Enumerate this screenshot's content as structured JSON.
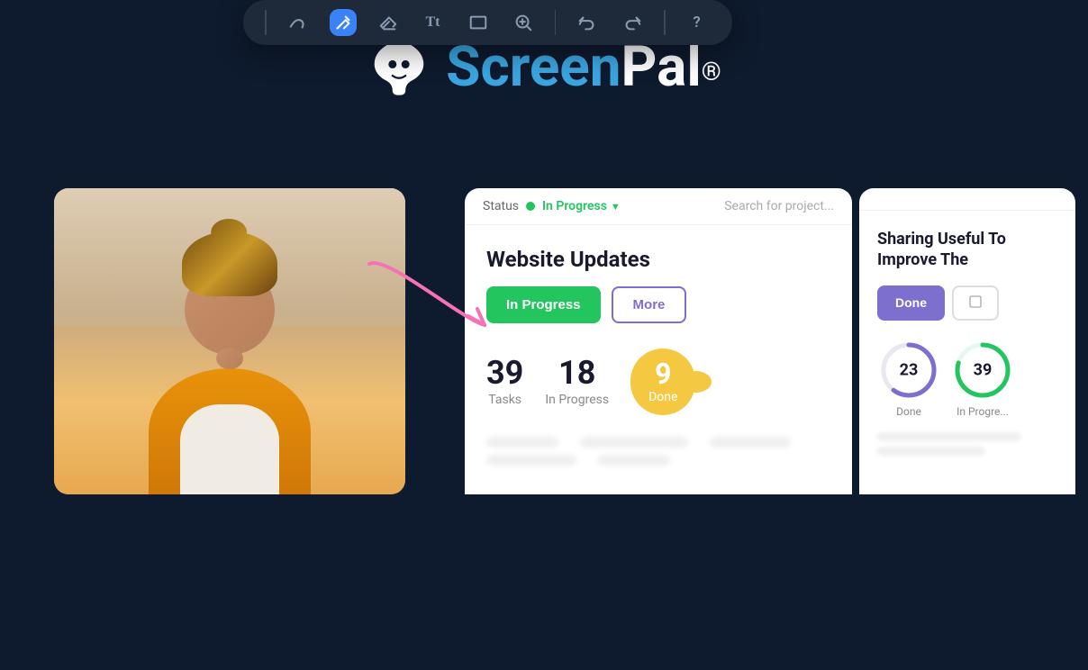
{
  "header": {
    "logo_screen": "Screen",
    "logo_pal": "Pal",
    "logo_reg": "®"
  },
  "toolbar": {
    "icons": [
      {
        "name": "line-icon",
        "symbol": "|",
        "active": false
      },
      {
        "name": "pen-icon",
        "symbol": "✏",
        "active": false
      },
      {
        "name": "highlighter-icon",
        "symbol": "✒",
        "active": true
      },
      {
        "name": "eraser-icon",
        "symbol": "◇",
        "active": false
      },
      {
        "name": "text-icon",
        "symbol": "Tt",
        "active": false
      },
      {
        "name": "rectangle-icon",
        "symbol": "□",
        "active": false
      },
      {
        "name": "zoom-icon",
        "symbol": "⊕",
        "active": false
      },
      {
        "name": "undo-icon",
        "symbol": "↩",
        "active": false
      },
      {
        "name": "redo-icon",
        "symbol": "↪",
        "active": false
      },
      {
        "name": "help-icon",
        "symbol": "?",
        "active": false
      }
    ]
  },
  "card_main": {
    "status_label": "Status",
    "status_value": "In Progress",
    "search_placeholder": "Search for project...",
    "project_title": "Website Updates",
    "btn_in_progress": "In Progress",
    "btn_more": "More",
    "tasks_count": "39",
    "tasks_label": "Tasks",
    "in_progress_count": "18",
    "in_progress_label": "In Progress",
    "done_count": "9",
    "done_label": "Done"
  },
  "card_secondary": {
    "title": "Sharing Useful To Improve The",
    "btn_done": "Done",
    "btn_more": "",
    "done_num": "23",
    "done_label": "Done",
    "in_progress_num": "39",
    "in_progress_label": "In Progre..."
  }
}
